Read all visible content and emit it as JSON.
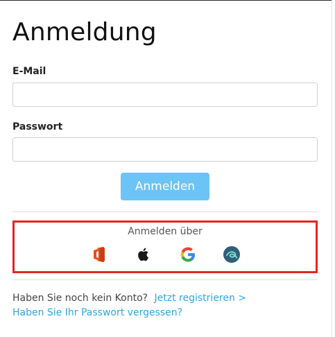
{
  "title": "Anmeldung",
  "email": {
    "label": "E-Mail",
    "value": "",
    "placeholder": ""
  },
  "password": {
    "label": "Passwort",
    "value": "",
    "placeholder": ""
  },
  "login_button": "Anmelden",
  "sso": {
    "title": "Anmelden über",
    "providers": [
      {
        "name": "office-icon"
      },
      {
        "name": "apple-icon"
      },
      {
        "name": "google-icon"
      },
      {
        "name": "eloquent-icon"
      }
    ]
  },
  "footer": {
    "no_account_text": "Haben Sie noch kein Konto?",
    "register_link": "Jetzt registrieren >",
    "forgot_password_link": "Haben Sie Ihr Passwort vergessen?"
  },
  "colors": {
    "primary_button": "#6cc3f5",
    "link": "#2ea6e0",
    "highlight_border": "#e0261f"
  }
}
